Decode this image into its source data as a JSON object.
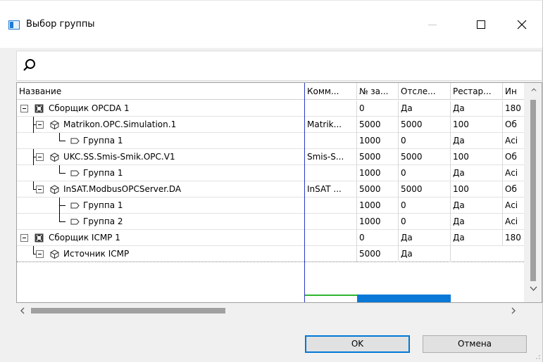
{
  "window": {
    "title": "Выбор группы"
  },
  "search": {
    "placeholder": ""
  },
  "grid": {
    "columns": [
      "Название",
      "Комм...",
      "№ за...",
      "Отсле...",
      "Рестар...",
      "Ин"
    ],
    "rows": [
      {
        "name": "Сборщик OPCDA 1",
        "comment": "",
        "num": "0",
        "track": "Да",
        "restart": "Да",
        "info": "180"
      },
      {
        "name": "Matrikon.OPC.Simulation.1",
        "comment": "Matrik...",
        "num": "5000",
        "track": "5000",
        "restart": "100",
        "info": "Об"
      },
      {
        "name": "Группа 1",
        "comment": "",
        "num": "1000",
        "track": "0",
        "restart": "Да",
        "info": "Асі"
      },
      {
        "name": "UKC.SS.Smis-Smik.OPC.V1",
        "comment": "Smis-S...",
        "num": "5000",
        "track": "5000",
        "restart": "100",
        "info": "Об"
      },
      {
        "name": "Группа 1",
        "comment": "",
        "num": "1000",
        "track": "0",
        "restart": "Да",
        "info": "Асі"
      },
      {
        "name": "InSAT.ModbusOPCServer.DA",
        "comment": "InSAT ...",
        "num": "5000",
        "track": "5000",
        "restart": "100",
        "info": "Об"
      },
      {
        "name": "Группа 1",
        "comment": "",
        "num": "1000",
        "track": "0",
        "restart": "Да",
        "info": "Асі"
      },
      {
        "name": "Группа 2",
        "comment": "",
        "num": "1000",
        "track": "0",
        "restart": "Да",
        "info": "Асі"
      },
      {
        "name": "Сборщик ICMP 1",
        "comment": "",
        "num": "0",
        "track": "Да",
        "restart": "Да",
        "info": "180"
      },
      {
        "name": "Источник ICMP",
        "comment": "",
        "num": "5000",
        "track": "Да",
        "restart": "",
        "info": ""
      }
    ]
  },
  "buttons": {
    "ok": "OK",
    "cancel": "Отмена"
  },
  "colors": {
    "accent": "#0078d7",
    "column_divider": "#2a38c8"
  }
}
